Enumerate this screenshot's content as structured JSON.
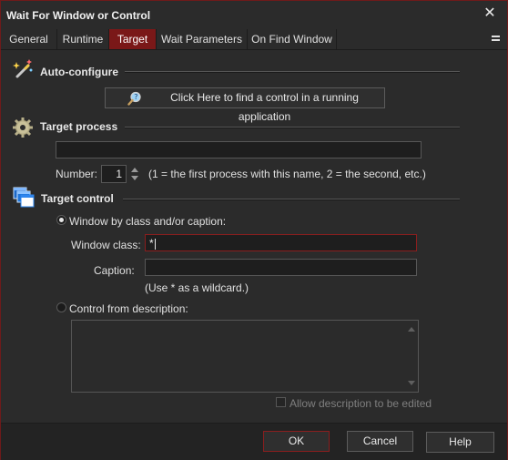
{
  "window": {
    "title": "Wait For Window or Control",
    "close_glyph": "✕"
  },
  "tabs": [
    {
      "label": "General",
      "active": false
    },
    {
      "label": "Runtime",
      "active": false
    },
    {
      "label": "Target",
      "active": true
    },
    {
      "label": "Wait Parameters",
      "active": false
    },
    {
      "label": "On Find Window",
      "active": false
    }
  ],
  "auto_configure": {
    "title": "Auto-configure",
    "button_label": "Click Here to find a control in a running application"
  },
  "target_process": {
    "title": "Target process",
    "process_value": "",
    "number_label": "Number:",
    "number_value": "1",
    "number_hint": "(1 = the first process with this name, 2 = the second, etc.)"
  },
  "target_control": {
    "title": "Target control",
    "radio_class_caption_label": "Window by class and/or caption:",
    "window_class_label": "Window class:",
    "window_class_value": "*",
    "caption_label": "Caption:",
    "caption_value": "",
    "wildcard_hint": "(Use * as a wildcard.)",
    "radio_description_label": "Control from description:",
    "description_value": "",
    "allow_edit_label": "Allow description to be edited"
  },
  "footer": {
    "ok_label": "OK",
    "cancel_label": "Cancel",
    "help_label": "Help"
  },
  "colors": {
    "accent": "#7a1818",
    "background": "#2b2b2b",
    "text": "#e2e2e2"
  },
  "icons": {
    "auto_configure": "magic-wand-icon",
    "target_process": "gear-cog-icon",
    "target_control": "windows-stack-icon",
    "find_button": "magnifier-icon"
  }
}
